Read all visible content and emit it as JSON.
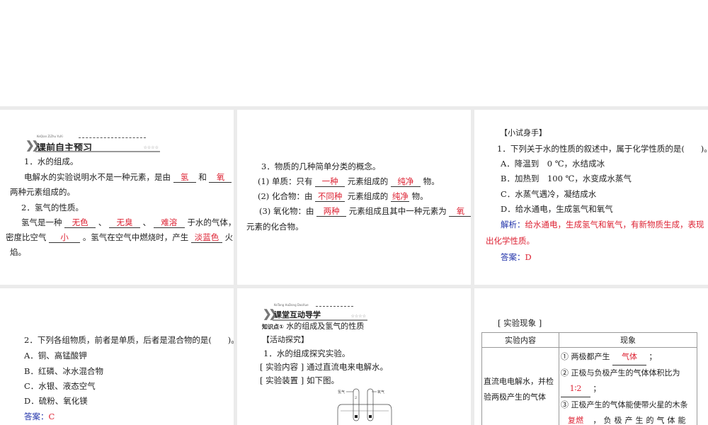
{
  "p1": {
    "header": "课前自主预习",
    "pinyin": "KeQian ZiZhu YuXi",
    "stars": "☆☆☆☆",
    "l1": "1．水的组成。",
    "l2a": "电解水的实验说明水不是一种元素，是由",
    "b1": "氢",
    "l2b": "和",
    "b2": "氧",
    "l3": "两种元素组成的。",
    "l4": "2．氢气的性质。",
    "l5a": "氢气是一种",
    "b3": "无色",
    "sep": "、",
    "b4": "无臭",
    "b5": "难溶",
    "l5b": "于水的气体，",
    "l6a": "密度比空气",
    "b6": "小",
    "l6b": "。氢气在空气中燃烧时，产生",
    "b7": "淡蓝色",
    "l6c": "火",
    "l7": "焰。"
  },
  "p2": {
    "l1": "3．物质的几种简单分类的概念。",
    "l2a": "(1) 单质：只有",
    "b1": "一种",
    "l2b": "元素组成的",
    "b2": "纯净",
    "l2c": "物。",
    "l3a": "(2) 化合物：由",
    "b3": "不同种",
    "l3b": "元素组成的",
    "b4": "纯净",
    "l3c": "物。",
    "l4a": "(3) 氧化物：由",
    "b5": "两种",
    "l4b": "元素组成且其中一种元素为",
    "b6": "氧",
    "l5": "元素的化合物。"
  },
  "p3": {
    "title": "【小试身手】",
    "q": "1．下列关于水的性质的叙述中，属于化学性质的是(　　)。",
    "a": "A．降温到　0 ℃，水结成冰",
    "b": "B．加热到　100 ℃，水变成水蒸气",
    "c": "C．水蒸气遇冷，凝结成水",
    "d": "D．给水通电，生成氢气和氧气",
    "analysis_label": "解析：",
    "analysis1": "给水通电，生成氢气和氧气，有新物质生成，表现",
    "analysis2": "出化学性质。",
    "answer_label": "答案：",
    "answer": "D"
  },
  "p4": {
    "q": "2．下列各组物质，前者是单质，后者是混合物的是(　　)。",
    "a": "A．铜、高锰酸钾",
    "b": "B．红磷、冰水混合物",
    "c": "C．水银、液态空气",
    "d": "D．硫粉、氧化镁",
    "answer_label": "答案：",
    "answer": "C"
  },
  "p5": {
    "header": "课堂互动导学",
    "pinyin": "KeTang HuDong DaoXue",
    "stars": "☆☆☆☆",
    "kp_label": "知识点①",
    "kp": "水的组成及氢气的性质",
    "activity": "【活动探究】",
    "l1": "1．水的组成探究实验。",
    "l2": "[ 实验内容 ] 通过直流电来电解水。",
    "l3": "[ 实验装置 ] 如下图。",
    "h2": "氢气",
    "o2": "氧气",
    "n2": "2",
    "n1": "1"
  },
  "p6": {
    "title": "[ 实验现象 ]",
    "th1": "实验内容",
    "th2": "现象",
    "content": "直流电电解水，并检验两极产生的气体",
    "o1a": "① 两极都产生",
    "o1b": "气体",
    "o1c": "；",
    "o2": "② 正极与负极产生的气体体积比为",
    "o2b": "1∶2",
    "o2c": "；",
    "o3": "③ 正极产生的气体能使带火星的木条",
    "o3b": "复燃",
    "o3c": "，负极产生的气体能"
  }
}
